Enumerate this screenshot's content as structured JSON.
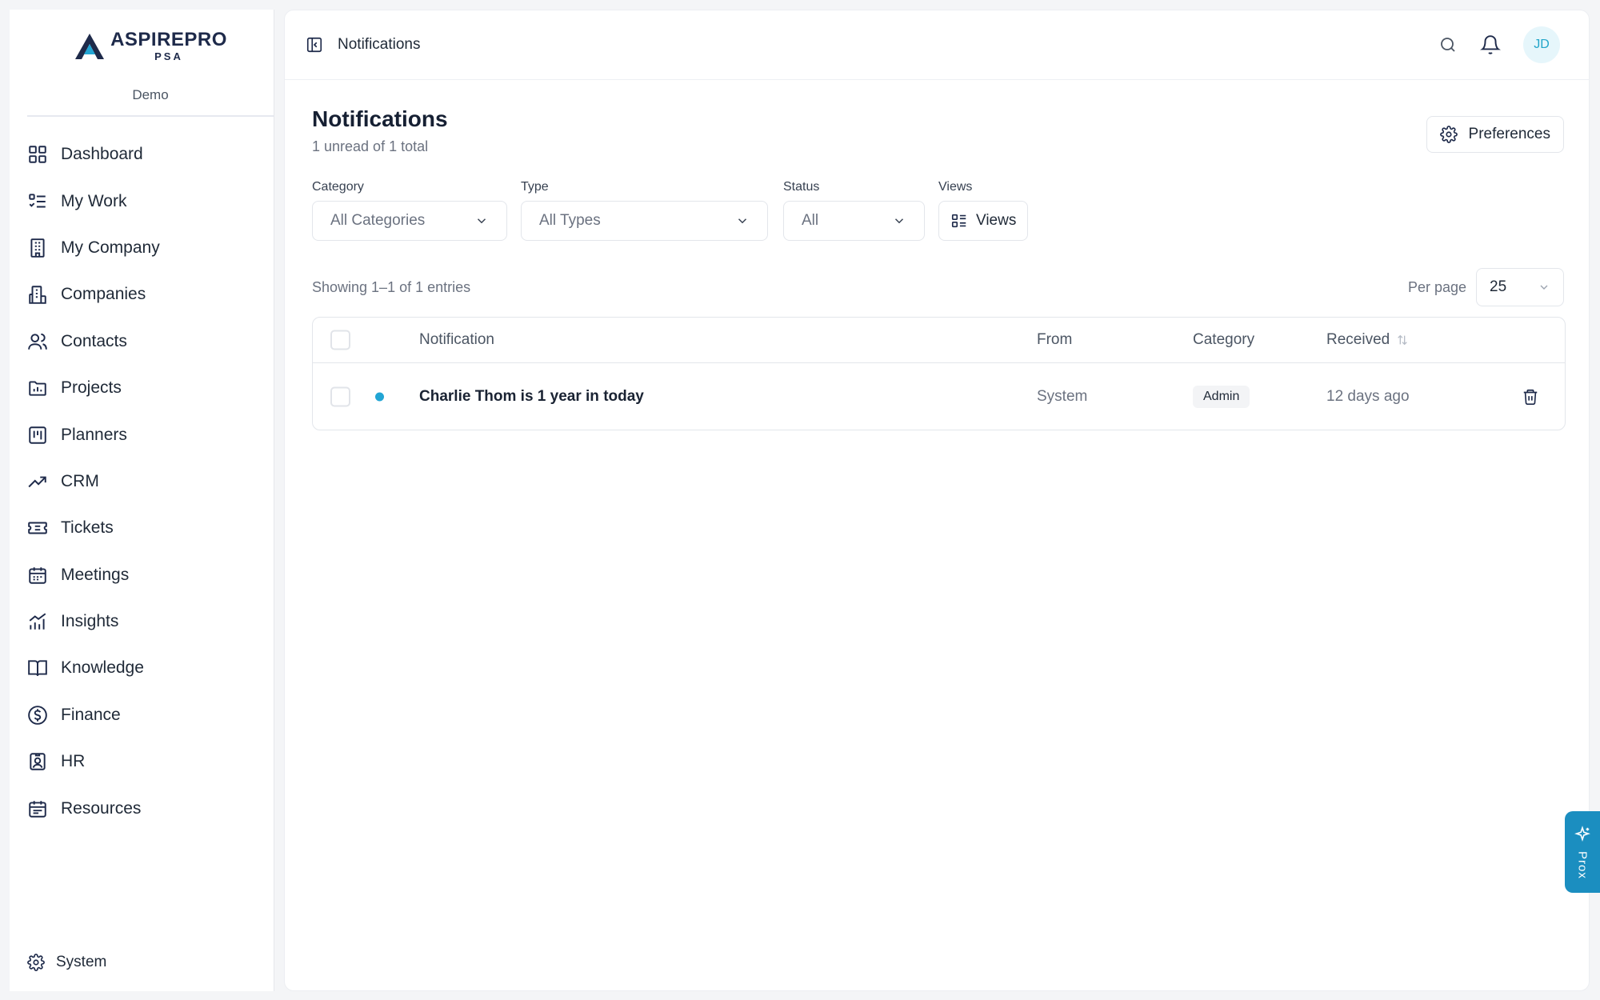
{
  "brand": {
    "name": "ASPIREPRO",
    "sub": "PSA",
    "tenant": "Demo"
  },
  "sidebar": {
    "items": [
      {
        "label": "Dashboard",
        "icon": "grid-icon"
      },
      {
        "label": "My Work",
        "icon": "checklist-icon"
      },
      {
        "label": "My Company",
        "icon": "building-icon"
      },
      {
        "label": "Companies",
        "icon": "buildings-icon"
      },
      {
        "label": "Contacts",
        "icon": "users-icon"
      },
      {
        "label": "Projects",
        "icon": "folder-chart-icon"
      },
      {
        "label": "Planners",
        "icon": "kanban-icon"
      },
      {
        "label": "CRM",
        "icon": "trend-up-icon"
      },
      {
        "label": "Tickets",
        "icon": "ticket-icon"
      },
      {
        "label": "Meetings",
        "icon": "calendar-icon"
      },
      {
        "label": "Insights",
        "icon": "bar-chart-icon"
      },
      {
        "label": "Knowledge",
        "icon": "book-icon"
      },
      {
        "label": "Finance",
        "icon": "dollar-circle-icon"
      },
      {
        "label": "HR",
        "icon": "badge-person-icon"
      },
      {
        "label": "Resources",
        "icon": "calendar-grid-icon"
      }
    ],
    "system_label": "System"
  },
  "topbar": {
    "title": "Notifications",
    "avatar": "JD"
  },
  "page": {
    "title": "Notifications",
    "subtitle": "1 unread of 1 total",
    "preferences_label": "Preferences"
  },
  "filters": {
    "category": {
      "label": "Category",
      "value": "All Categories"
    },
    "type": {
      "label": "Type",
      "value": "All Types"
    },
    "status": {
      "label": "Status",
      "value": "All"
    },
    "views": {
      "label": "Views",
      "button": "Views"
    }
  },
  "listing": {
    "showing": "Showing 1–1 of 1 entries",
    "per_page_label": "Per page",
    "per_page_value": "25"
  },
  "table": {
    "headers": {
      "notification": "Notification",
      "from": "From",
      "category": "Category",
      "received": "Received"
    },
    "rows": [
      {
        "notification": "Charlie Thom is 1 year in today",
        "from": "System",
        "category": "Admin",
        "received": "12 days ago",
        "unread": true
      }
    ]
  },
  "assistant": {
    "label": "Prox"
  },
  "colors": {
    "accent": "#22a5d4",
    "brand_navy": "#1e2a4a",
    "assistant_bg": "#1b8ec0"
  }
}
